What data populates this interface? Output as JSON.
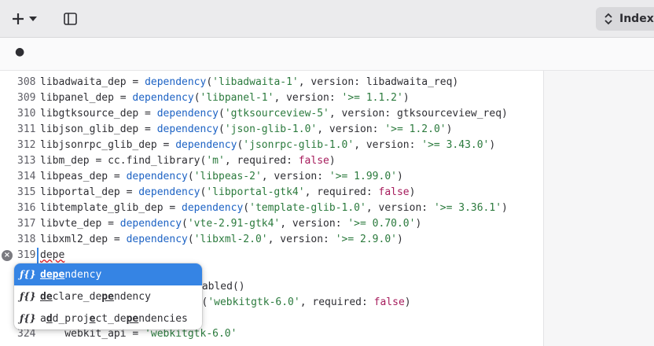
{
  "header": {
    "new_icon": "plus-icon",
    "dropdown_icon": "chevron-down-icon",
    "sidebar_icon": "sidebar-toggle-icon",
    "indexing_label": "Indexi"
  },
  "tab": {
    "modified_indicator": "●"
  },
  "editor": {
    "lines": [
      {
        "num": "308",
        "segs": [
          [
            "libadwaita_dep = ",
            ""
          ],
          [
            "dependency",
            "fn"
          ],
          [
            "(",
            ""
          ],
          [
            "'libadwaita-1'",
            "str"
          ],
          [
            ", version: libadwaita_req)",
            ""
          ]
        ]
      },
      {
        "num": "309",
        "segs": [
          [
            "libpanel_dep = ",
            ""
          ],
          [
            "dependency",
            "fn"
          ],
          [
            "(",
            ""
          ],
          [
            "'libpanel-1'",
            "str"
          ],
          [
            ", version: ",
            ""
          ],
          [
            "'>= 1.1.2'",
            "str"
          ],
          [
            ")",
            ""
          ]
        ]
      },
      {
        "num": "310",
        "segs": [
          [
            "libgtksource_dep = ",
            ""
          ],
          [
            "dependency",
            "fn"
          ],
          [
            "(",
            ""
          ],
          [
            "'gtksourceview-5'",
            "str"
          ],
          [
            ", version: gtksourceview_req)",
            ""
          ]
        ]
      },
      {
        "num": "311",
        "segs": [
          [
            "libjson_glib_dep = ",
            ""
          ],
          [
            "dependency",
            "fn"
          ],
          [
            "(",
            ""
          ],
          [
            "'json-glib-1.0'",
            "str"
          ],
          [
            ", version: ",
            ""
          ],
          [
            "'>= 1.2.0'",
            "str"
          ],
          [
            ")",
            ""
          ]
        ]
      },
      {
        "num": "312",
        "segs": [
          [
            "libjsonrpc_glib_dep = ",
            ""
          ],
          [
            "dependency",
            "fn"
          ],
          [
            "(",
            ""
          ],
          [
            "'jsonrpc-glib-1.0'",
            "str"
          ],
          [
            ", version: ",
            ""
          ],
          [
            "'>= 3.43.0'",
            "str"
          ],
          [
            ")",
            ""
          ]
        ]
      },
      {
        "num": "313",
        "segs": [
          [
            "libm_dep = cc.find_library(",
            ""
          ],
          [
            "'m'",
            "str"
          ],
          [
            ", required: ",
            ""
          ],
          [
            "false",
            "kw"
          ],
          [
            ")",
            ""
          ]
        ]
      },
      {
        "num": "314",
        "segs": [
          [
            "libpeas_dep = ",
            ""
          ],
          [
            "dependency",
            "fn"
          ],
          [
            "(",
            ""
          ],
          [
            "'libpeas-2'",
            "str"
          ],
          [
            ", version: ",
            ""
          ],
          [
            "'>= 1.99.0'",
            "str"
          ],
          [
            ")",
            ""
          ]
        ]
      },
      {
        "num": "315",
        "segs": [
          [
            "libportal_dep = ",
            ""
          ],
          [
            "dependency",
            "fn"
          ],
          [
            "(",
            ""
          ],
          [
            "'libportal-gtk4'",
            "str"
          ],
          [
            ", required: ",
            ""
          ],
          [
            "false",
            "kw"
          ],
          [
            ")",
            ""
          ]
        ]
      },
      {
        "num": "316",
        "segs": [
          [
            "libtemplate_glib_dep = ",
            ""
          ],
          [
            "dependency",
            "fn"
          ],
          [
            "(",
            ""
          ],
          [
            "'template-glib-1.0'",
            "str"
          ],
          [
            ", version: ",
            ""
          ],
          [
            "'>= 3.36.1'",
            "str"
          ],
          [
            ")",
            ""
          ]
        ]
      },
      {
        "num": "317",
        "segs": [
          [
            "libvte_dep = ",
            ""
          ],
          [
            "dependency",
            "fn"
          ],
          [
            "(",
            ""
          ],
          [
            "'vte-2.91-gtk4'",
            "str"
          ],
          [
            ", version: ",
            ""
          ],
          [
            "'>= 0.70.0'",
            "str"
          ],
          [
            ")",
            ""
          ]
        ]
      },
      {
        "num": "318",
        "segs": [
          [
            "libxml2_dep = ",
            ""
          ],
          [
            "dependency",
            "fn"
          ],
          [
            "(",
            ""
          ],
          [
            "'libxml-2.0'",
            "str"
          ],
          [
            ", version: ",
            ""
          ],
          [
            "'>= 2.9.0'",
            "str"
          ],
          [
            ")",
            ""
          ]
        ]
      },
      {
        "num": "319",
        "segs": [
          [
            "depe",
            ""
          ]
        ]
      },
      {
        "num": "",
        "segs": []
      },
      {
        "num": "",
        "segs": [
          [
            "nabled()",
            ""
          ]
        ]
      },
      {
        "num": "",
        "segs": [
          [
            "ncy(",
            ""
          ],
          [
            "'webkitgtk-6.0'",
            "str"
          ],
          [
            ", required: ",
            ""
          ],
          [
            "false",
            "kw"
          ],
          [
            ")",
            ""
          ]
        ]
      },
      {
        "num": "",
        "segs": []
      },
      {
        "num": "324",
        "segs": [
          [
            "    webkit_api = ",
            ""
          ],
          [
            "'webkitgtk-6.0'",
            "str"
          ]
        ]
      }
    ]
  },
  "completion": {
    "icon": "function-icon",
    "icon_text": "ƒ{}",
    "items": [
      {
        "parts": [
          [
            "depe",
            "m"
          ],
          [
            "ndency",
            ""
          ]
        ]
      },
      {
        "parts": [
          [
            "de",
            "m"
          ],
          [
            "clare_de",
            ""
          ],
          [
            "pe",
            "m"
          ],
          [
            "ndency",
            ""
          ]
        ]
      },
      {
        "parts": [
          [
            "a",
            ""
          ],
          [
            "d",
            "m"
          ],
          [
            "d_proj",
            ""
          ],
          [
            "e",
            "m"
          ],
          [
            "ct_de",
            ""
          ],
          [
            "pe",
            "m"
          ],
          [
            "ndencies",
            ""
          ]
        ]
      }
    ]
  }
}
